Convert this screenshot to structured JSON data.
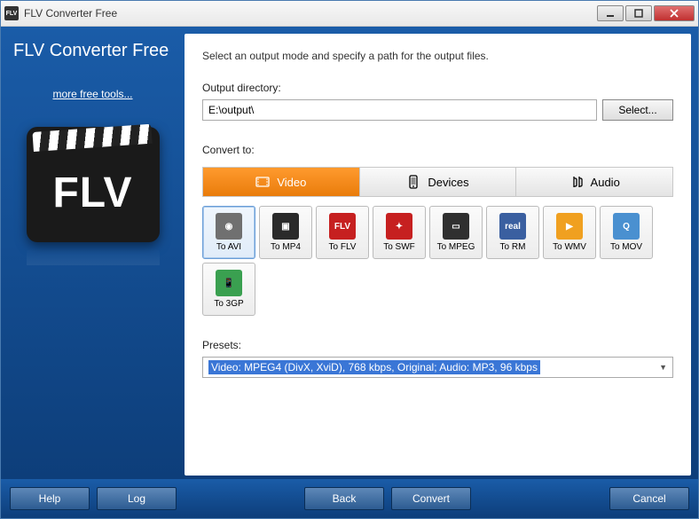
{
  "window": {
    "title": "FLV Converter Free"
  },
  "brand": "FLV Converter Free",
  "sidebar": {
    "more_link": "more free tools...",
    "logo_text": "FLV"
  },
  "main": {
    "instruction": "Select an output mode and specify a path for the output files.",
    "output_label": "Output directory:",
    "output_value": "E:\\output\\",
    "select_btn": "Select...",
    "convert_label": "Convert to:",
    "tabs": [
      {
        "label": "Video",
        "active": true
      },
      {
        "label": "Devices",
        "active": false
      },
      {
        "label": "Audio",
        "active": false
      }
    ],
    "formats": [
      {
        "label": "To AVI",
        "selected": true,
        "bg": "#707070",
        "sym": "◉"
      },
      {
        "label": "To MP4",
        "selected": false,
        "bg": "#2a2a2a",
        "sym": "▣"
      },
      {
        "label": "To FLV",
        "selected": false,
        "bg": "#c62020",
        "sym": "FLV"
      },
      {
        "label": "To SWF",
        "selected": false,
        "bg": "#c62020",
        "sym": "✦"
      },
      {
        "label": "To MPEG",
        "selected": false,
        "bg": "#303030",
        "sym": "▭"
      },
      {
        "label": "To RM",
        "selected": false,
        "bg": "#3a5fa0",
        "sym": "real"
      },
      {
        "label": "To WMV",
        "selected": false,
        "bg": "#f0a020",
        "sym": "▶"
      },
      {
        "label": "To MOV",
        "selected": false,
        "bg": "#4a90d0",
        "sym": "Q"
      },
      {
        "label": "To 3GP",
        "selected": false,
        "bg": "#3aa050",
        "sym": "📱"
      }
    ],
    "presets_label": "Presets:",
    "preset_value": "Video: MPEG4 (DivX, XviD), 768 kbps, Original; Audio: MP3, 96 kbps"
  },
  "footer": {
    "help": "Help",
    "log": "Log",
    "back": "Back",
    "convert": "Convert",
    "cancel": "Cancel"
  }
}
